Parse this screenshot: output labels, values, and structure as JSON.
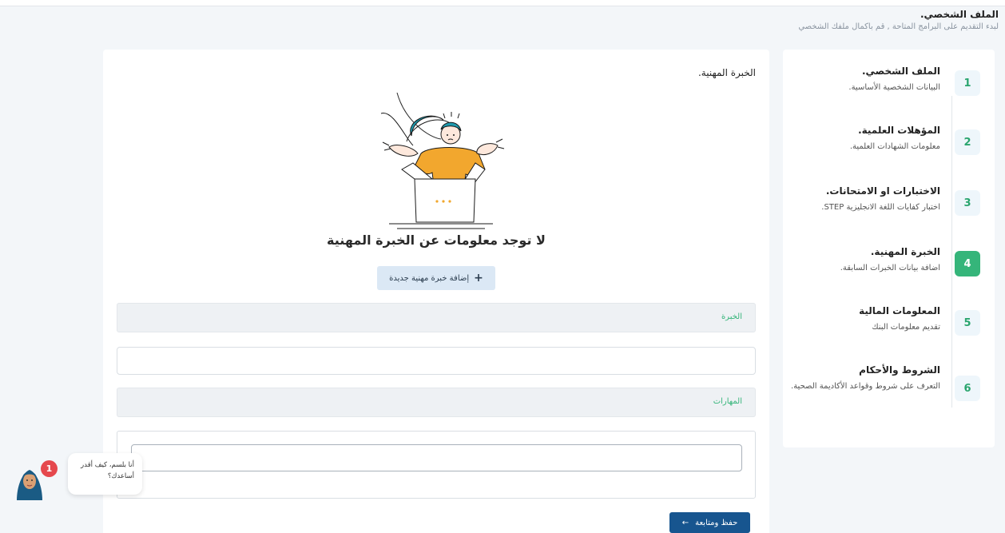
{
  "header": {
    "title": "الملف الشخصي.",
    "subtitle": "لبدء التقديم على البرامج المتاحة , قم باكمال ملفك الشخصي"
  },
  "steps": [
    {
      "num": "1",
      "title": "الملف الشخصي.",
      "desc": "البيانات الشخصية الأساسية."
    },
    {
      "num": "2",
      "title": "المؤهلات العلمية.",
      "desc": "معلومات الشهادات العلمية."
    },
    {
      "num": "3",
      "title": "الاختبارات او الامتحانات.",
      "desc": "اختبار كفايات اللغة الانجليزية STEP."
    },
    {
      "num": "4",
      "title": "الخبرة المهنية.",
      "desc": "اضافة بيانات الخبرات السابقة."
    },
    {
      "num": "5",
      "title": "المعلومات المالية",
      "desc": "تقديم معلومات البنك"
    },
    {
      "num": "6",
      "title": "الشروط والأحكام",
      "desc": "التعرف على شروط وقواعد الأكاديمة الصحية."
    }
  ],
  "active_step": 4,
  "main": {
    "section_title": "الخبرة المهنية.",
    "empty_heading": "لا توجد معلومات عن الخبرة المهنية",
    "add_button_label": "إضافة خبرة مهنية جديدة",
    "add_button_icon": "plus-icon",
    "experience_label": "الخبرة",
    "experience_value": "",
    "skills_label": "المهارات",
    "skills_value": "",
    "save_button_label": "حفظ ومتابعة",
    "save_button_icon": "arrow-left-icon"
  },
  "chat": {
    "badge_count": "1",
    "message": "أنا بلسم، كيف أقدر أساعدك؟"
  },
  "colors": {
    "accent_green": "#35b57a",
    "primary_blue": "#17558f",
    "badge_red": "#e5484d"
  }
}
